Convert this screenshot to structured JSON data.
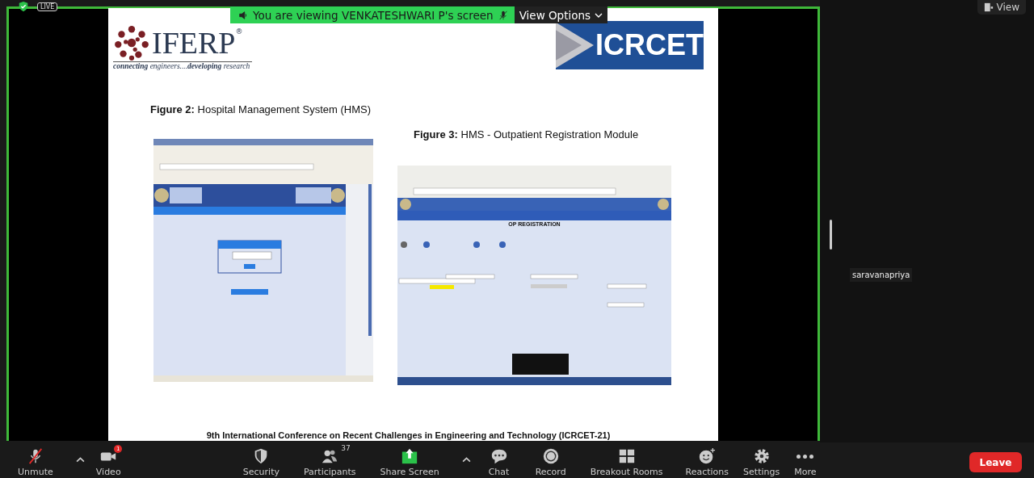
{
  "share_status": {
    "live_badge": "LIVE"
  },
  "banner": {
    "text": "You are viewing VENKATESHWARI P's screen",
    "view_options": "View Options"
  },
  "view_button": "View",
  "slide": {
    "logo_left": {
      "name": "IFERP",
      "mark": "®",
      "tagline": "**connecting** engineers....**developing** research"
    },
    "logo_right": "ICRCET",
    "figures": [
      {
        "caption": "**Figure 2:** Hospital Management System (HMS)",
        "kind": "login"
      },
      {
        "caption": "**Figure 3:** HMS  - Outpatient Registration Module",
        "kind": "registration",
        "heading": "OP REGISTRATION"
      }
    ],
    "footer": "9th International Conference on Recent Challenges in Engineering and Technology (ICRCET-21)"
  },
  "participant": {
    "name": "saravanapriya"
  },
  "toolbar": {
    "items": [
      {
        "kind": "mic",
        "label": "Unmute",
        "muted": true,
        "has_options": true
      },
      {
        "kind": "video",
        "label": "Video",
        "badge": "1",
        "has_options": false
      },
      {
        "kind": "security",
        "label": "Security",
        "has_options": false
      },
      {
        "kind": "participants",
        "label": "Participants",
        "count": "37",
        "has_options": false
      },
      {
        "kind": "share",
        "label": "Share Screen",
        "has_options": true
      },
      {
        "kind": "chat",
        "label": "Chat",
        "has_options": false
      },
      {
        "kind": "record",
        "label": "Record",
        "has_options": false
      },
      {
        "kind": "breakout",
        "label": "Breakout Rooms",
        "has_options": false
      },
      {
        "kind": "reactions",
        "label": "Reactions",
        "has_options": false
      },
      {
        "kind": "settings",
        "label": "Settings",
        "has_options": false
      },
      {
        "kind": "more",
        "label": "More",
        "has_options": false
      }
    ],
    "leave": "Leave"
  }
}
